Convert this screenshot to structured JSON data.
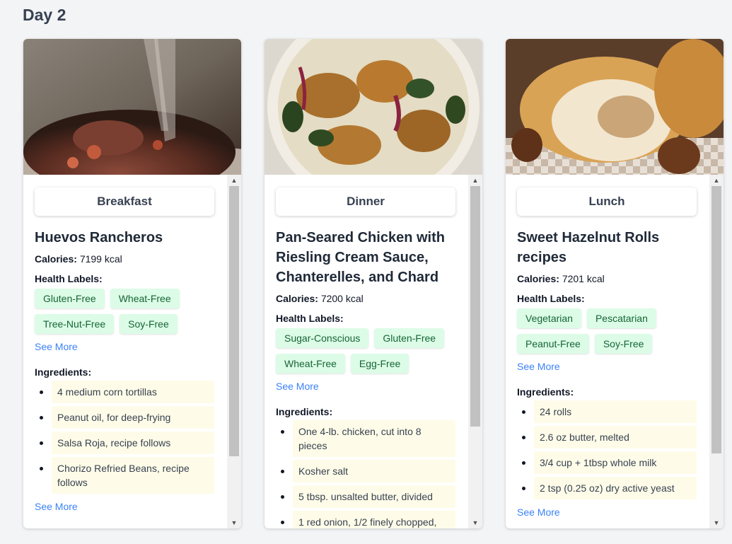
{
  "page": {
    "day_title": "Day 2"
  },
  "colors": {
    "label_bg": "#dcfce7",
    "label_text": "#166534",
    "ingredient_bg": "#fefce8",
    "link": "#3b82f6"
  },
  "cards": [
    {
      "image_icon": "huevos-rancheros-photo",
      "meal_type": "Breakfast",
      "title": "Huevos Rancheros",
      "calories_label": "Calories:",
      "calories_value": "7199 kcal",
      "health_labels_heading": "Health Labels:",
      "health_labels": [
        "Gluten-Free",
        "Wheat-Free",
        "Tree-Nut-Free",
        "Soy-Free"
      ],
      "see_more_labels": "See More",
      "ingredients_heading": "Ingredients:",
      "ingredients": [
        "4 medium corn tortillas",
        "Peanut oil, for deep-frying",
        "Salsa Roja, recipe follows",
        "Chorizo Refried Beans, recipe follows"
      ],
      "see_more_ingredients": "See More",
      "scroll_position": 0.0
    },
    {
      "image_icon": "pan-seared-chicken-photo",
      "meal_type": "Dinner",
      "title": "Pan-Seared Chicken with Riesling Cream Sauce, Chanterelles, and Chard",
      "calories_label": "Calories:",
      "calories_value": "7200 kcal",
      "health_labels_heading": "Health Labels:",
      "health_labels": [
        "Sugar-Conscious",
        "Gluten-Free",
        "Wheat-Free",
        "Egg-Free"
      ],
      "see_more_labels": "See More",
      "ingredients_heading": "Ingredients:",
      "ingredients": [
        "One 4-lb. chicken, cut into 8 pieces",
        "Kosher salt",
        "5 tbsp. unsalted butter, divided",
        "1 red onion, 1/2 finely chopped,"
      ],
      "see_more_ingredients": "",
      "scroll_position": 0.0
    },
    {
      "image_icon": "hazelnut-rolls-photo",
      "meal_type": "Lunch",
      "title": "Sweet Hazelnut Rolls recipes",
      "calories_label": "Calories:",
      "calories_value": "7201 kcal",
      "health_labels_heading": "Health Labels:",
      "health_labels": [
        "Vegetarian",
        "Pescatarian",
        "Peanut-Free",
        "Soy-Free"
      ],
      "see_more_labels": "See More",
      "ingredients_heading": "Ingredients:",
      "ingredients": [
        "24 rolls",
        "2.6 oz butter, melted",
        "3/4 cup + 1tbsp whole milk",
        "2 tsp (0.25 oz) dry active yeast"
      ],
      "see_more_ingredients": "See More",
      "scroll_position": 0.0
    }
  ]
}
